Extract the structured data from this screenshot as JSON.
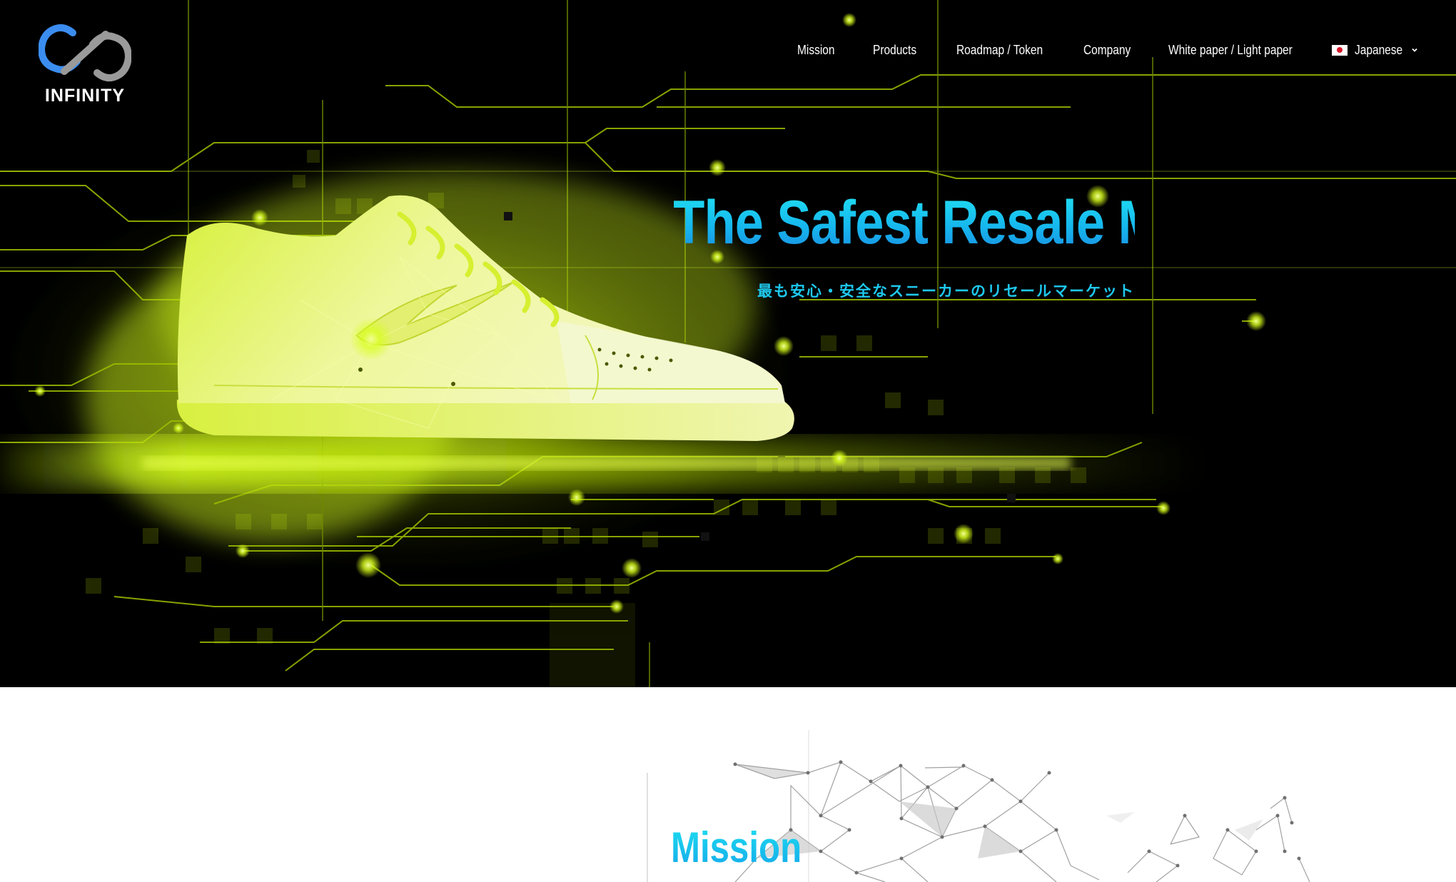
{
  "brand": {
    "name": "INFINITY",
    "logo_icon": "infinity-logo-icon",
    "colors": {
      "ring_blue": "#3b8df0",
      "ring_gray": "#9a9a9a"
    }
  },
  "nav": {
    "items": [
      {
        "label": "Mission"
      },
      {
        "label": "Products"
      },
      {
        "label": "Roadmap / Token"
      },
      {
        "label": "Company"
      },
      {
        "label": "White paper / Light paper"
      }
    ],
    "language": {
      "label": "Japanese",
      "flag_icon": "japan-flag-icon",
      "dropdown_icon": "chevron-down-icon"
    }
  },
  "hero": {
    "title": "The Safest Resale Market",
    "subtitle": "最も安心・安全なスニーカーのリセールマーケット",
    "colors": {
      "background": "#000000",
      "glow": "#d8ff1a",
      "title_top": "#22e6f2",
      "title_bottom": "#1a86e0"
    }
  },
  "mission": {
    "title": "Mission"
  }
}
